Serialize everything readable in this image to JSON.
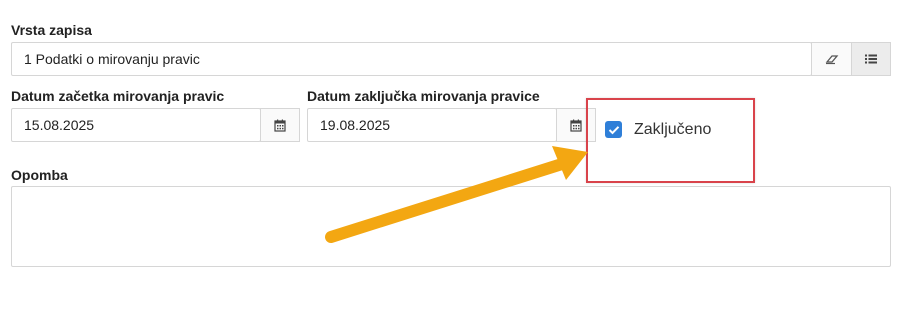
{
  "form": {
    "record_type": {
      "label": "Vrsta zapisa",
      "value": "1 Podatki o mirovanju pravic"
    },
    "start_date": {
      "label": "Datum začetka mirovanja pravic",
      "value": "15.08.2025"
    },
    "end_date": {
      "label": "Datum zaključka mirovanja pravice",
      "value": "19.08.2025"
    },
    "closed": {
      "label": "Zaključeno",
      "checked": true
    },
    "note": {
      "label": "Opomba",
      "value": ""
    }
  },
  "icons": {
    "clear": "eraser-icon",
    "list": "list-icon",
    "calendar": "calendar-icon",
    "check": "check-icon"
  },
  "colors": {
    "checkbox": "#2f7fd8",
    "highlight": "#d9434b",
    "arrow": "#f3a712"
  }
}
